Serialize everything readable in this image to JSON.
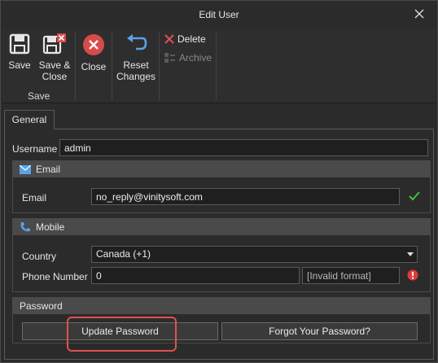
{
  "window": {
    "title": "Edit User"
  },
  "ribbon": {
    "save_label": "Save",
    "save_close_label": "Save &\nClose",
    "close_label": "Close",
    "reset_label": "Reset\nChanges",
    "delete_label": "Delete",
    "archive_label": "Archive",
    "group_save_label": "Save"
  },
  "tabs": {
    "general_label": "General"
  },
  "form": {
    "username_label": "Username",
    "username_value": "admin",
    "email_section": "Email",
    "email_label": "Email",
    "email_value": "no_reply@vinitysoft.com",
    "mobile_section": "Mobile",
    "country_label": "Country",
    "country_value": "Canada (+1)",
    "phone_label": "Phone Number",
    "phone_value": "0",
    "phone_status": "[Invalid format]",
    "password_section": "Password",
    "update_password_label": "Update Password",
    "forgot_password_label": "Forgot Your Password?"
  },
  "colors": {
    "accent_red": "#e0524f",
    "valid_green": "#3fbf4a",
    "icon_blue": "#5aa2e6",
    "error_red": "#e03a3a"
  }
}
